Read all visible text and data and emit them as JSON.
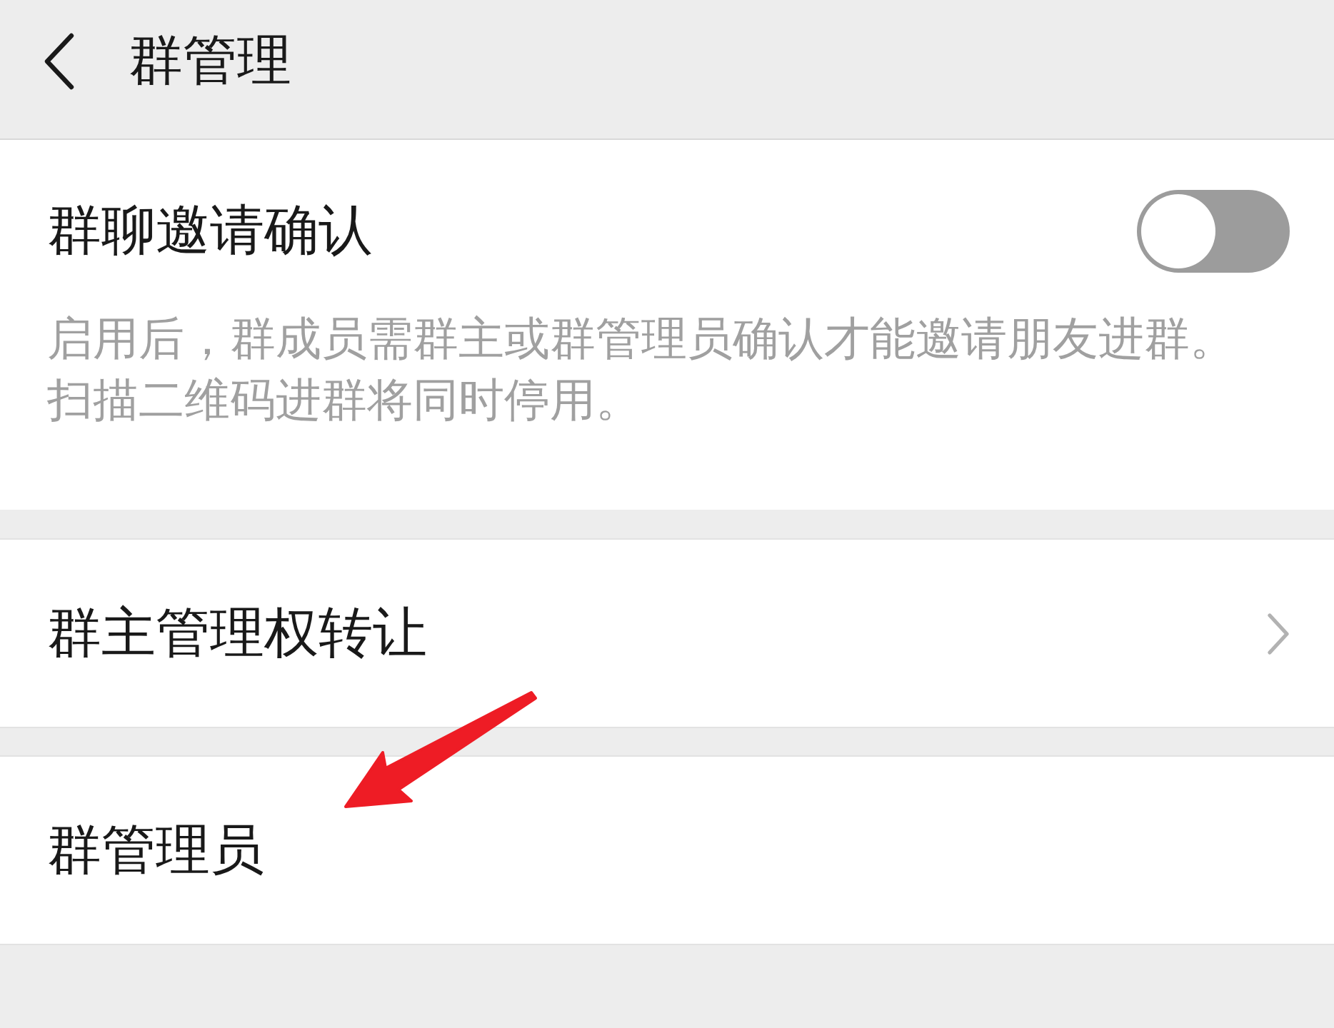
{
  "header": {
    "title": "群管理"
  },
  "sections": [
    {
      "kind": "toggle",
      "label": "群聊邀请确认",
      "on": false,
      "description": "启用后，群成员需群主或群管理员确认才能邀请朋友进群。扫描二维码进群将同时停用。"
    },
    {
      "kind": "link",
      "label": "群主管理权转让",
      "chevron": true,
      "annotated": false
    },
    {
      "kind": "link",
      "label": "群管理员",
      "chevron": false,
      "annotated": true
    }
  ]
}
